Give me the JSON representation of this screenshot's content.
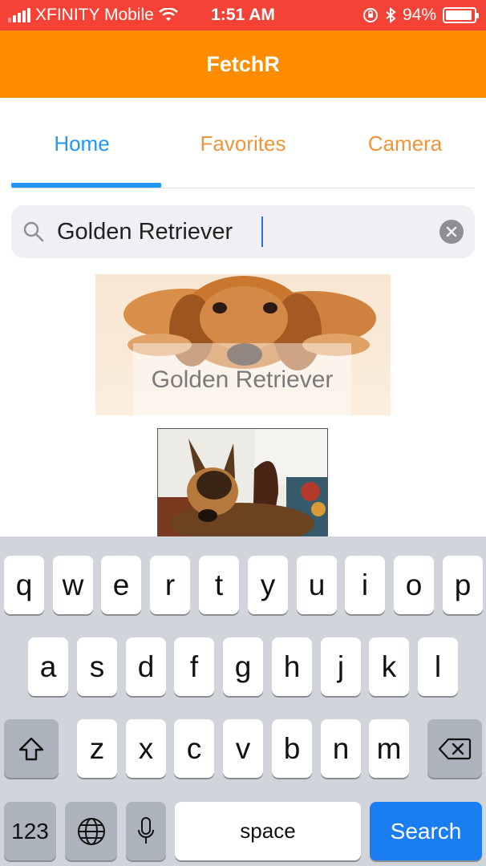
{
  "status_bar": {
    "carrier": "XFINITY Mobile",
    "time": "1:51 AM",
    "battery_text": "94%",
    "battery_level": 0.94,
    "icons": [
      "signal-icon",
      "wifi-icon",
      "rotation-lock-icon",
      "bluetooth-icon",
      "battery-icon"
    ]
  },
  "app_bar": {
    "title": "FetchR",
    "color": "#ff8c00"
  },
  "tabs": [
    {
      "label": "Home",
      "active": true
    },
    {
      "label": "Favorites",
      "active": false
    },
    {
      "label": "Camera",
      "active": false
    }
  ],
  "search": {
    "value": "Golden Retriever",
    "placeholder": "",
    "icons": [
      "search-icon",
      "clear-icon"
    ]
  },
  "results": [
    {
      "caption": "Golden Retriever",
      "image": "golden-retriever-photo"
    },
    {
      "caption": "",
      "image": "german-shepherd-photo"
    }
  ],
  "keyboard": {
    "row1": [
      "q",
      "w",
      "e",
      "r",
      "t",
      "y",
      "u",
      "i",
      "o",
      "p"
    ],
    "row2": [
      "a",
      "s",
      "d",
      "f",
      "g",
      "h",
      "j",
      "k",
      "l"
    ],
    "row3": [
      "z",
      "x",
      "c",
      "v",
      "b",
      "n",
      "m"
    ],
    "numbers_label": "123",
    "space_label": "space",
    "return_label": "Search",
    "icons": [
      "shift-icon",
      "backspace-icon",
      "globe-icon",
      "microphone-icon"
    ]
  },
  "colors": {
    "status_bar": "#f44336",
    "accent": "#2196f3",
    "tab_inactive": "#f0943a",
    "search_key": "#1a7ef2"
  }
}
